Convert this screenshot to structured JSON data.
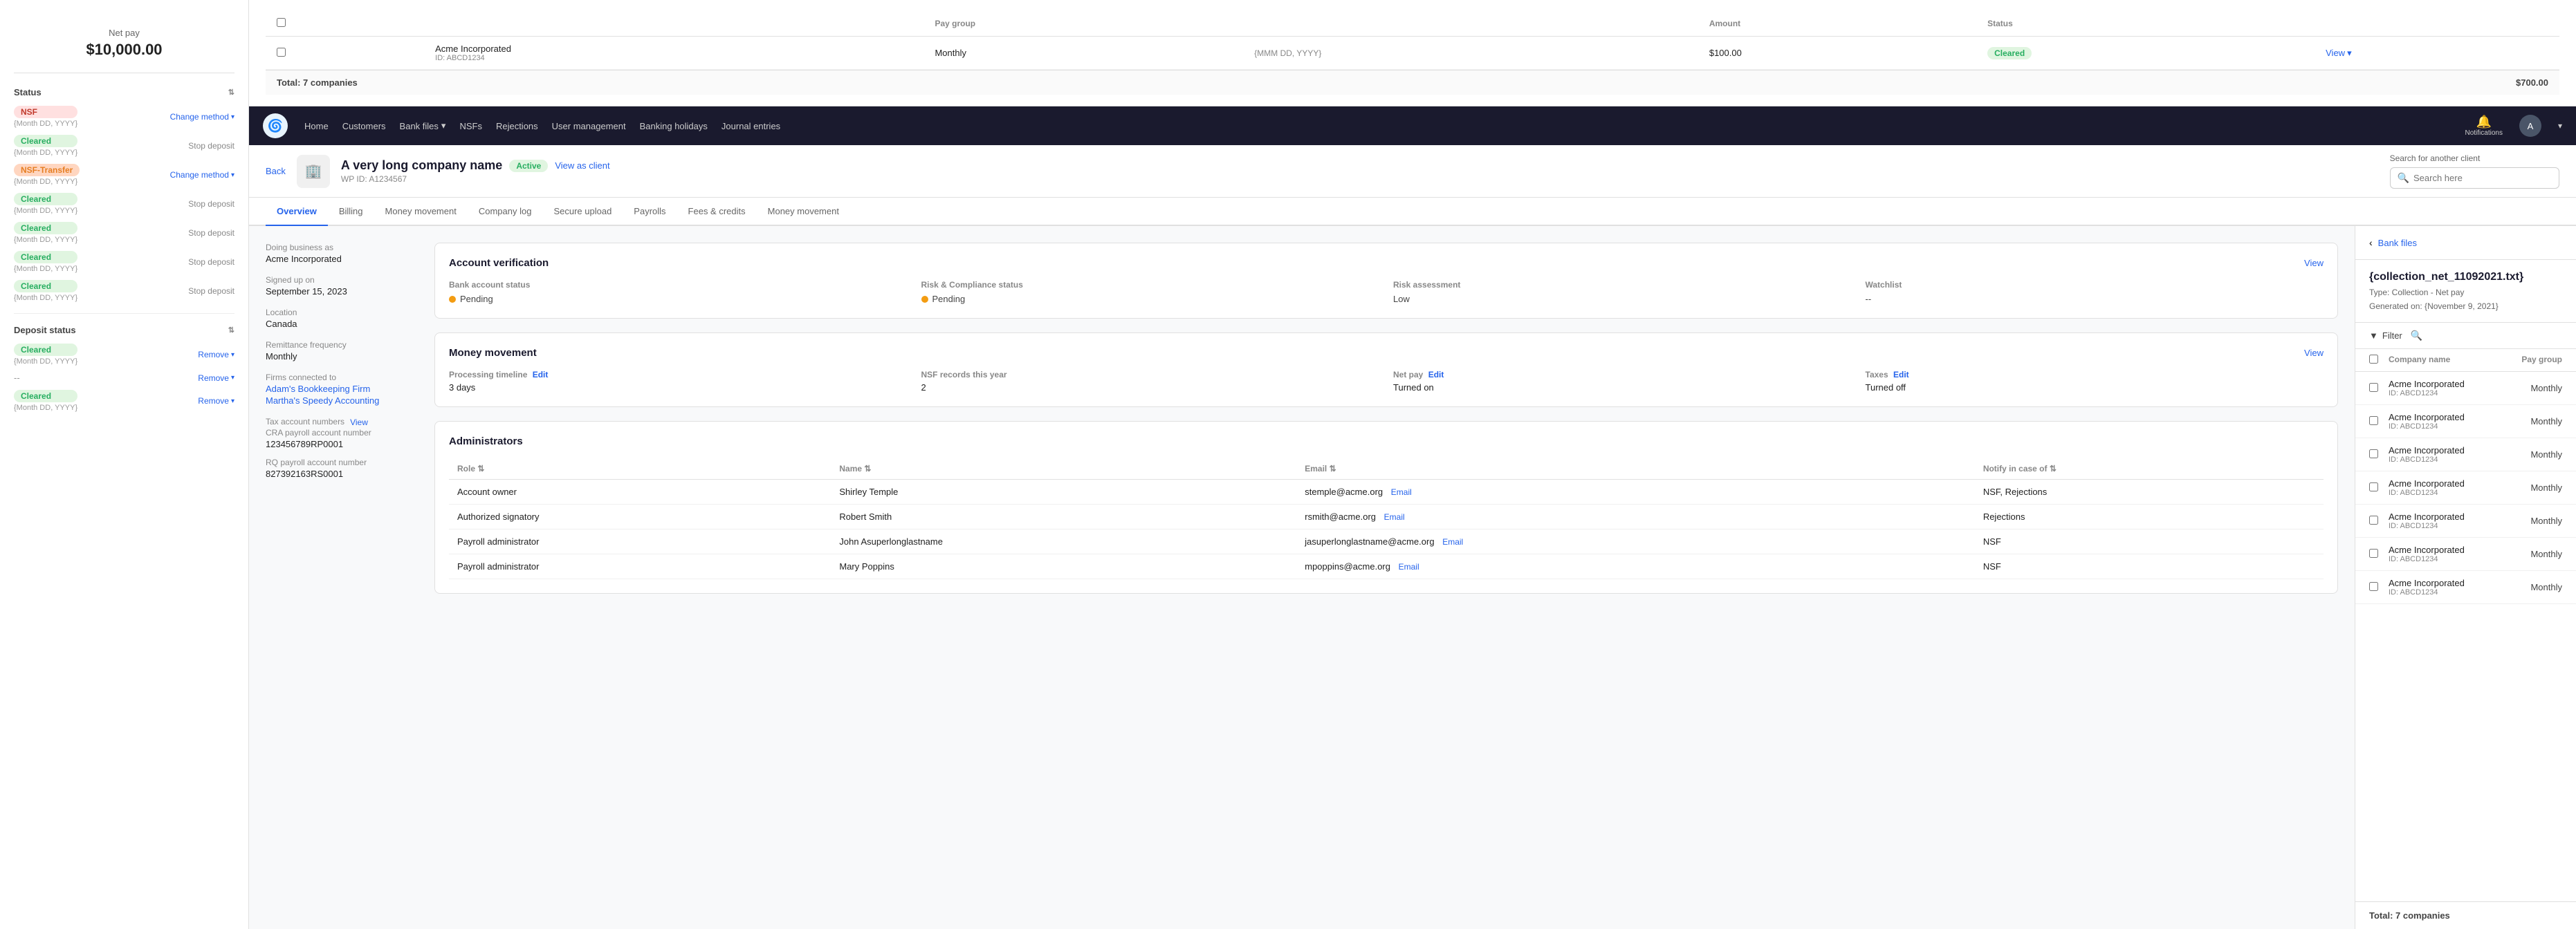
{
  "leftPanel": {
    "netPay": {
      "label": "Net pay",
      "amount": "$10,000.00"
    },
    "statusHeader": "Status",
    "statuses": [
      {
        "badge": "NSF",
        "badgeType": "nsf",
        "date": "{Month DD, YYYY}",
        "action": "Change method",
        "actionType": "change"
      },
      {
        "badge": "Cleared",
        "badgeType": "cleared",
        "date": "{Month DD, YYYY}",
        "action": "Stop deposit",
        "actionType": "stop"
      },
      {
        "badge": "NSF-Transfer",
        "badgeType": "nsf-transfer",
        "date": "{Month DD, YYYY}",
        "action": "Change method",
        "actionType": "change"
      },
      {
        "badge": "Cleared",
        "badgeType": "cleared",
        "date": "{Month DD, YYYY}",
        "action": "Stop deposit",
        "actionType": "stop"
      },
      {
        "badge": "Cleared",
        "badgeType": "cleared",
        "date": "{Month DD, YYYY}",
        "action": "Stop deposit",
        "actionType": "stop"
      },
      {
        "badge": "Cleared",
        "badgeType": "cleared",
        "date": "{Month DD, YYYY}",
        "action": "Stop deposit",
        "actionType": "stop"
      },
      {
        "badge": "Cleared",
        "badgeType": "cleared",
        "date": "{Month DD, YYYY}",
        "action": "Stop deposit",
        "actionType": "stop"
      }
    ],
    "depositStatusHeader": "Deposit status",
    "depositStatuses": [
      {
        "badge": "Cleared",
        "badgeType": "cleared",
        "date": "{Month DD, YYYY}",
        "action": "Remove",
        "actionType": "remove"
      },
      {
        "badge": "--",
        "badgeType": "none",
        "date": "",
        "action": "Remove",
        "actionType": "remove"
      },
      {
        "badge": "Cleared",
        "badgeType": "cleared",
        "date": "{Month DD, YYYY}",
        "action": "Remove",
        "actionType": "remove"
      }
    ]
  },
  "topNav": {
    "navItems": [
      {
        "label": "Home",
        "hasChevron": false
      },
      {
        "label": "Customers",
        "hasChevron": false
      },
      {
        "label": "Bank files",
        "hasChevron": true
      },
      {
        "label": "NSFs",
        "hasChevron": false
      },
      {
        "label": "Rejections",
        "hasChevron": false
      },
      {
        "label": "User management",
        "hasChevron": false
      },
      {
        "label": "Banking holidays",
        "hasChevron": false
      },
      {
        "label": "Journal entries",
        "hasChevron": false
      }
    ],
    "notifications": "Notifications",
    "avatarInitial": "A"
  },
  "clientBar": {
    "backLabel": "Back",
    "companyName": "A very long company name",
    "activeLabel": "Active",
    "viewAsClient": "View as client",
    "wpId": "WP ID: A1234567",
    "searchPlaceholder": "Search here",
    "searchLabel": "Search for another client"
  },
  "tabs": [
    {
      "label": "Overview",
      "active": true
    },
    {
      "label": "Billing",
      "active": false
    },
    {
      "label": "Money movement",
      "active": false
    },
    {
      "label": "Company log",
      "active": false
    },
    {
      "label": "Secure upload",
      "active": false
    },
    {
      "label": "Payrolls",
      "active": false
    },
    {
      "label": "Fees & credits",
      "active": false
    },
    {
      "label": "Money movement",
      "active": false
    }
  ],
  "overview": {
    "doingBusinessAs": {
      "label": "Doing business as",
      "value": "Acme Incorporated"
    },
    "signedUpOn": {
      "label": "Signed up on",
      "value": "September 15, 2023"
    },
    "location": {
      "label": "Location",
      "value": "Canada"
    },
    "remittanceFrequency": {
      "label": "Remittance frequency",
      "value": "Monthly"
    },
    "firmsConnected": {
      "label": "Firms connected to",
      "firms": [
        "Adam's Bookkeeping Firm",
        "Martha's Speedy Accounting"
      ]
    },
    "taxAccountNumbers": {
      "label": "Tax account numbers",
      "viewLabel": "View",
      "cra": {
        "label": "CRA payroll account number",
        "value": "123456789RP0001"
      },
      "rq": {
        "label": "RQ payroll account number",
        "value": "827392163RS0001"
      }
    }
  },
  "accountVerification": {
    "title": "Account verification",
    "viewLabel": "View",
    "bankAccountStatus": {
      "colLabel": "Bank account status",
      "value": "Pending"
    },
    "riskComplianceStatus": {
      "colLabel": "Risk & Compliance status",
      "value": "Pending"
    },
    "riskAssessment": {
      "colLabel": "Risk assessment",
      "value": "Low"
    },
    "watchlist": {
      "colLabel": "Watchlist",
      "value": "--"
    }
  },
  "moneyMovement": {
    "title": "Money movement",
    "viewLabel": "View",
    "processingTimeline": {
      "label": "Processing timeline",
      "editLabel": "Edit",
      "value": "3 days"
    },
    "nsfRecords": {
      "label": "NSF records this year",
      "value": "2"
    },
    "netPay": {
      "label": "Net pay",
      "editLabel": "Edit",
      "value": "Turned on"
    },
    "taxes": {
      "label": "Taxes",
      "editLabel": "Edit",
      "value": "Turned off"
    }
  },
  "administrators": {
    "title": "Administrators",
    "columns": [
      {
        "label": "Role ⇅"
      },
      {
        "label": "Name ⇅"
      },
      {
        "label": "Email ⇅"
      },
      {
        "label": "Notify in case of ⇅"
      }
    ],
    "rows": [
      {
        "role": "Account owner",
        "name": "Shirley Temple",
        "email": "stemple@acme.org",
        "notify": "NSF, Rejections",
        "emailLabel": "Email"
      },
      {
        "role": "Authorized signatory",
        "name": "Robert Smith",
        "email": "rsmith@acme.org",
        "notify": "Rejections",
        "emailLabel": "Email"
      },
      {
        "role": "Payroll administrator",
        "name": "John Asuperlonglastname",
        "email": "jasuperlonglastname@acme.org",
        "notify": "NSF",
        "emailLabel": "Email"
      },
      {
        "role": "Payroll administrator",
        "name": "Mary Poppins",
        "email": "mpoppins@acme.org",
        "notify": "NSF",
        "emailLabel": "Email"
      }
    ]
  },
  "topTable": {
    "headers": [
      "",
      "",
      "Pay group",
      "",
      "Amount",
      "Status",
      ""
    ],
    "rows": [
      {
        "company": "Acme Incorporated",
        "id": "ID: ABCD1234",
        "payGroup": "Monthly",
        "amount": "$100.00",
        "date": "{MMM DD, YYYY}",
        "status": "Cleared",
        "viewLabel": "View"
      }
    ],
    "footer": {
      "label": "Total: 7 companies",
      "amount": "$700.00"
    }
  },
  "bankFiles": {
    "backLabel": "Bank files",
    "filename": "{collection_net_11092021.txt}",
    "typeLine": "Type: Collection - Net pay",
    "generatedLine": "Generated on: {November 9, 2021}",
    "filterLabel": "Filter",
    "tableHeaders": {
      "companyName": "Company name",
      "payGroup": "Pay group"
    },
    "rows": [
      {
        "company": "Acme Incorporated",
        "id": "ID: ABCD1234",
        "payGroup": "Monthly"
      },
      {
        "company": "Acme Incorporated",
        "id": "ID: ABCD1234",
        "payGroup": "Monthly"
      },
      {
        "company": "Acme Incorporated",
        "id": "ID: ABCD1234",
        "payGroup": "Monthly"
      },
      {
        "company": "Acme Incorporated",
        "id": "ID: ABCD1234",
        "payGroup": "Monthly"
      },
      {
        "company": "Acme Incorporated",
        "id": "ID: ABCD1234",
        "payGroup": "Monthly"
      },
      {
        "company": "Acme Incorporated",
        "id": "ID: ABCD1234",
        "payGroup": "Monthly"
      },
      {
        "company": "Acme Incorporated",
        "id": "ID: ABCD1234",
        "payGroup": "Monthly"
      }
    ],
    "footer": "Total: 7 companies"
  }
}
